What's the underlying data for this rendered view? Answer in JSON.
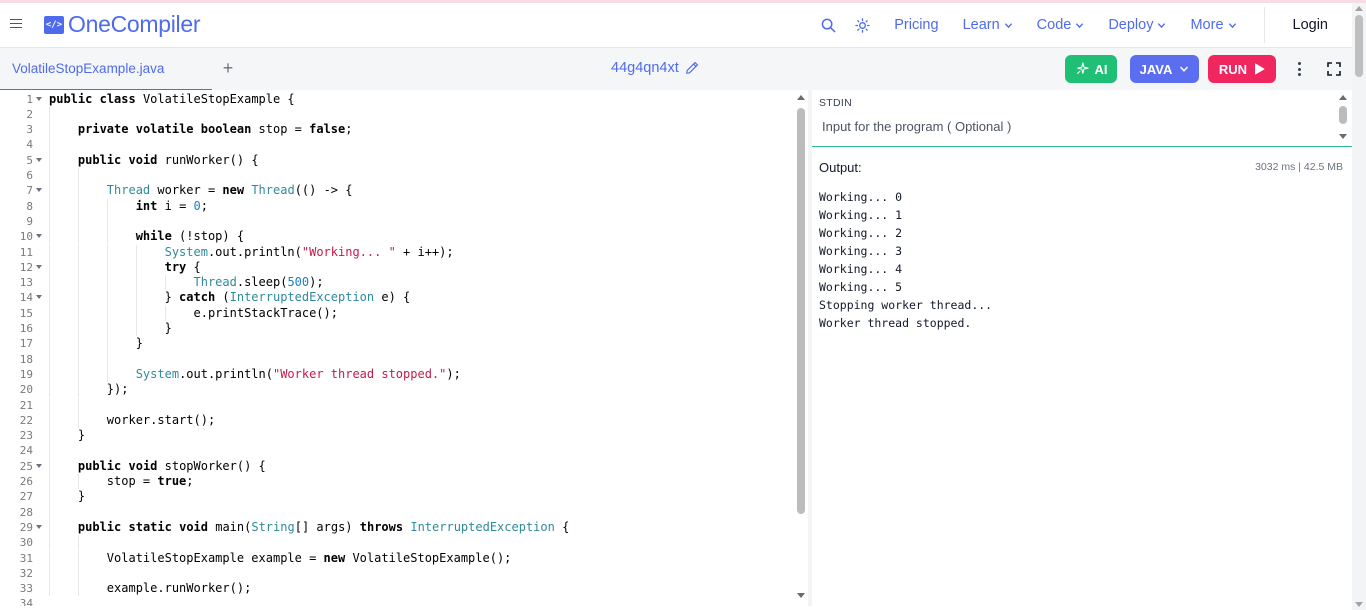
{
  "header": {
    "brand": "OneCompiler",
    "brand_icon": "</>",
    "nav": [
      {
        "label": "Pricing",
        "dropdown": false
      },
      {
        "label": "Learn",
        "dropdown": true
      },
      {
        "label": "Code",
        "dropdown": true
      },
      {
        "label": "Deploy",
        "dropdown": true
      },
      {
        "label": "More",
        "dropdown": true
      }
    ],
    "login": "Login"
  },
  "toolbar": {
    "file_tab": "VolatileStopExample.java",
    "add_tab": "+",
    "project_id": "44g4qn4xt",
    "ai_label": "AI",
    "language_label": "JAVA",
    "run_label": "RUN"
  },
  "editor": {
    "lines": [
      "public class VolatileStopExample {",
      "",
      "    private volatile boolean stop = false;",
      "",
      "    public void runWorker() {",
      "",
      "        Thread worker = new Thread(() -> {",
      "            int i = 0;",
      "",
      "            while (!stop) {",
      "                System.out.println(\"Working... \" + i++);",
      "                try {",
      "                    Thread.sleep(500);",
      "                } catch (InterruptedException e) {",
      "                    e.printStackTrace();",
      "                }",
      "            }",
      "",
      "            System.out.println(\"Worker thread stopped.\");",
      "        });",
      "",
      "        worker.start();",
      "    }",
      "",
      "    public void stopWorker() {",
      "        stop = true;",
      "    }",
      "",
      "    public static void main(String[] args) throws InterruptedException {",
      "",
      "        VolatileStopExample example = new VolatileStopExample();",
      "",
      "        example.runWorker();",
      ""
    ],
    "fold_lines": [
      1,
      5,
      7,
      10,
      12,
      14,
      25,
      29
    ]
  },
  "stdin": {
    "label": "STDIN",
    "placeholder": "Input for the program ( Optional )"
  },
  "output": {
    "label": "Output:",
    "stats": "3032 ms | 42.5 MB",
    "lines": [
      "Working... 0",
      "Working... 1",
      "Working... 2",
      "Working... 3",
      "Working... 4",
      "Working... 5",
      "Stopping worker thread...",
      "Worker thread stopped."
    ]
  },
  "colors": {
    "brand": "#4f6bed",
    "ai_button": "#1fbf76",
    "java_button": "#5b6ef0",
    "run_button": "#f0275f",
    "stdin_border": "#2bbf88"
  }
}
